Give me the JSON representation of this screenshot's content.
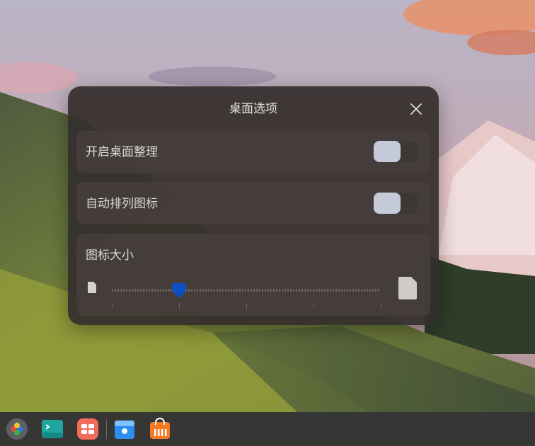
{
  "dialog": {
    "title": "桌面选项",
    "rows": [
      {
        "label": "开启桌面整理",
        "enabled": false
      },
      {
        "label": "自动排列图标",
        "enabled": false
      }
    ],
    "icon_size": {
      "label": "图标大小",
      "value": 1,
      "min": 0,
      "max": 4
    }
  },
  "taskbar": {
    "icons": [
      "launcher-icon",
      "terminal-icon",
      "multitask-icon",
      "file-manager-icon",
      "app-store-icon"
    ]
  },
  "colors": {
    "accent": "#0f4fc4",
    "dialog_bg": "#342e2c",
    "toggle_knob": "#c5cad9"
  }
}
